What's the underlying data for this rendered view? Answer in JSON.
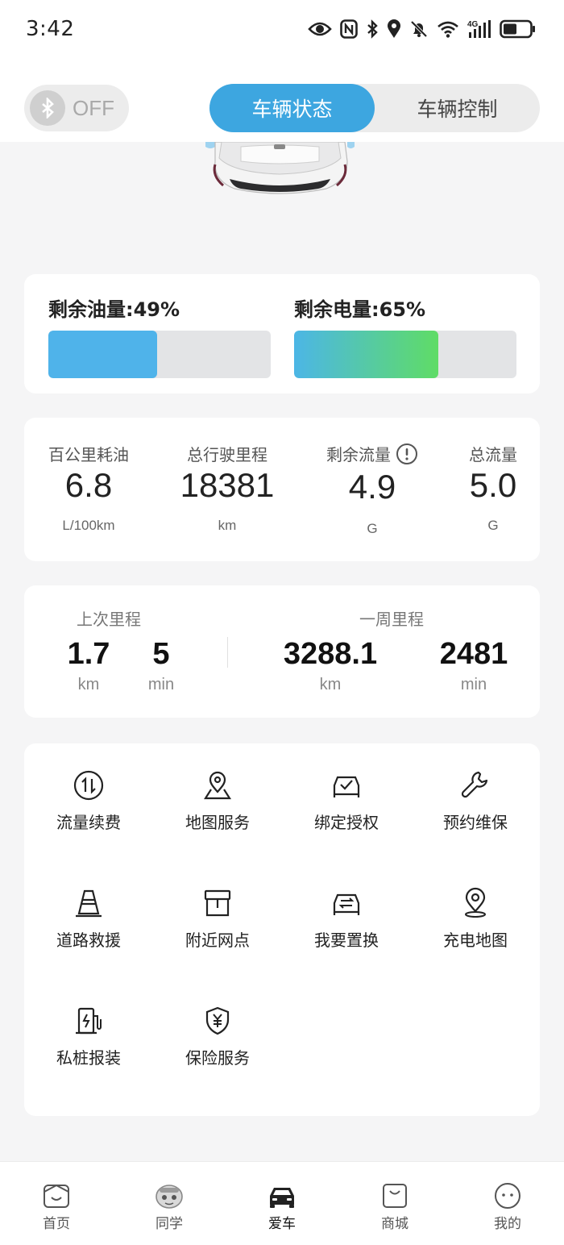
{
  "status_bar": {
    "time": "3:42",
    "icons": [
      "eye-icon",
      "nfc-icon",
      "bluetooth-icon",
      "location-icon",
      "mute-icon",
      "wifi-icon",
      "4g-signal-icon",
      "battery-icon"
    ],
    "network_label": "4G"
  },
  "header": {
    "bluetooth_toggle": {
      "label": "OFF",
      "state": "off"
    },
    "tabs": [
      {
        "label": "车辆状态",
        "active": true
      },
      {
        "label": "车辆控制",
        "active": false
      }
    ],
    "accent_color": "#3da6e0"
  },
  "gauges": {
    "fuel": {
      "label": "剩余油量:49%",
      "percent": 49
    },
    "battery": {
      "label": "剩余电量:65%",
      "percent": 65
    }
  },
  "stats": [
    {
      "label": "百公里耗油",
      "value": "6.8",
      "unit": "L/100km",
      "has_info_icon": false
    },
    {
      "label": "总行驶里程",
      "value": "18381",
      "unit": "km",
      "has_info_icon": false
    },
    {
      "label": "剩余流量",
      "value": "4.9",
      "unit": "G",
      "has_info_icon": true
    },
    {
      "label": "总流量",
      "value": "5.0",
      "unit": "G",
      "has_info_icon": false
    }
  ],
  "mileage": {
    "last_trip": {
      "title": "上次里程",
      "distance": {
        "value": "1.7",
        "unit": "km"
      },
      "duration": {
        "value": "5",
        "unit": "min"
      }
    },
    "week": {
      "title": "一周里程",
      "distance": {
        "value": "3288.1",
        "unit": "km"
      },
      "duration": {
        "value": "2481",
        "unit": "min"
      }
    }
  },
  "services": [
    {
      "label": "流量续费",
      "icon": "data-swap-icon"
    },
    {
      "label": "地图服务",
      "icon": "map-pin-icon"
    },
    {
      "label": "绑定授权",
      "icon": "car-check-icon"
    },
    {
      "label": "预约维保",
      "icon": "wrench-icon"
    },
    {
      "label": "道路救援",
      "icon": "traffic-cone-icon"
    },
    {
      "label": "附近网点",
      "icon": "store-icon"
    },
    {
      "label": "我要置换",
      "icon": "car-exchange-icon"
    },
    {
      "label": "充电地图",
      "icon": "location-icon"
    },
    {
      "label": "私桩报装",
      "icon": "charging-pile-icon"
    },
    {
      "label": "保险服务",
      "icon": "shield-yen-icon"
    }
  ],
  "tabbar": [
    {
      "label": "首页",
      "icon": "home-icon",
      "active": false
    },
    {
      "label": "同学",
      "icon": "classmates-icon",
      "active": false
    },
    {
      "label": "爱车",
      "icon": "car-icon",
      "active": true
    },
    {
      "label": "商城",
      "icon": "shop-icon",
      "active": false
    },
    {
      "label": "我的",
      "icon": "profile-face-icon",
      "active": false
    }
  ]
}
